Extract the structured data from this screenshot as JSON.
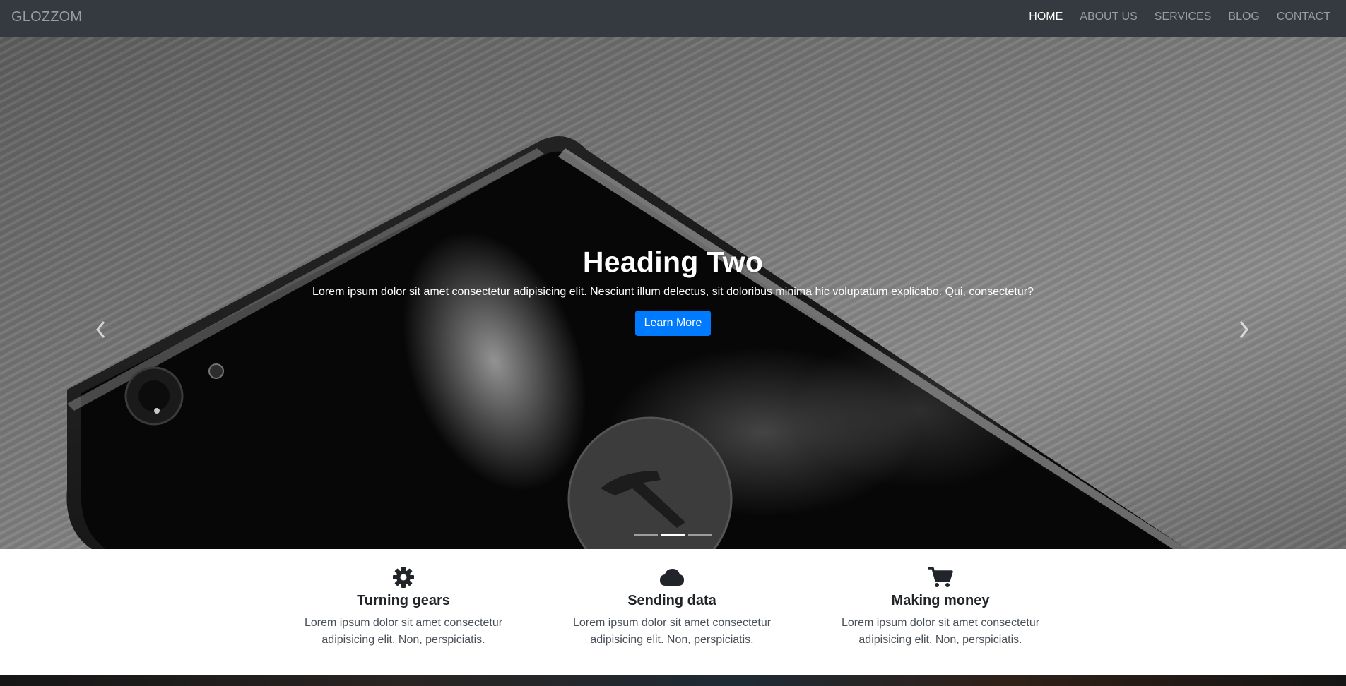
{
  "navbar": {
    "brand": "GLOZZOM",
    "links": [
      {
        "label": "HOME",
        "active": true
      },
      {
        "label": "ABOUT US",
        "active": false
      },
      {
        "label": "SERVICES",
        "active": false
      },
      {
        "label": "BLOG",
        "active": false
      },
      {
        "label": "CONTACT",
        "active": false
      }
    ]
  },
  "hero": {
    "title": "Heading Two",
    "text": "Lorem ipsum dolor sit amet consectetur adipisicing elit. Nesciunt illum delectus, sit doloribus minima hic voluptatum explicabo. Qui, consectetur?",
    "button_label": "Learn More",
    "prev_icon": "chevron-left-icon",
    "next_icon": "chevron-right-icon",
    "active_slide": 2,
    "slide_count": 3
  },
  "features": [
    {
      "icon": "gear-icon",
      "title": "Turning gears",
      "text_line1": "Lorem ipsum dolor sit amet consectetur",
      "text_line2": "adipisicing elit. Non, perspiciatis."
    },
    {
      "icon": "cloud-icon",
      "title": "Sending data",
      "text_line1": "Lorem ipsum dolor sit amet consectetur",
      "text_line2": "adipisicing elit. Non, perspiciatis."
    },
    {
      "icon": "cart-icon",
      "title": "Making money",
      "text_line1": "Lorem ipsum dolor sit amet consectetur",
      "text_line2": "adipisicing elit. Non, perspiciatis."
    }
  ],
  "colors": {
    "navbar_bg": "#343a40",
    "accent": "#007bff",
    "text_dark": "#212529"
  }
}
